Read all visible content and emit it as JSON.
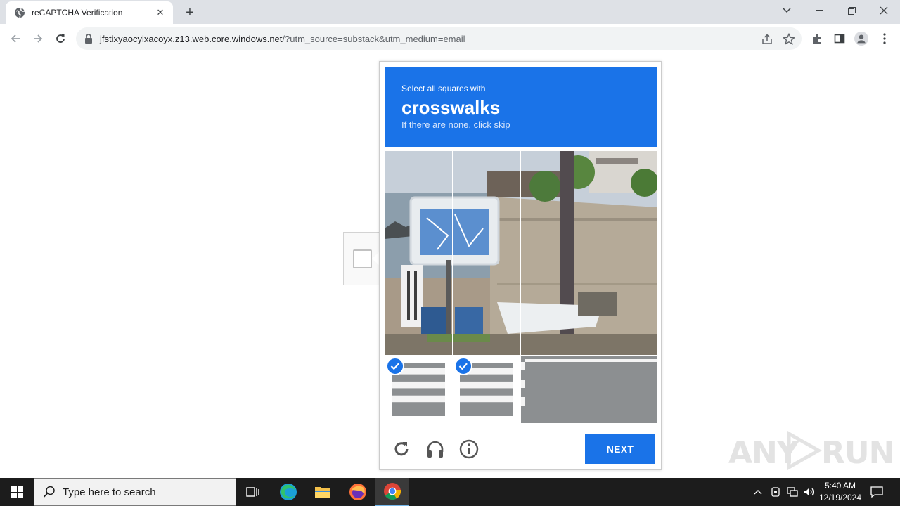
{
  "browser": {
    "tab_title": "reCAPTCHA Verification",
    "tab_close": "✕",
    "new_tab": "+",
    "url_host": "jfstixyaocyixacoyx.z13.web.core.windows.net",
    "url_rest": "/?utm_source=substack&utm_medium=email"
  },
  "captcha": {
    "instruction_small": "Select all squares with",
    "target": "crosswalks",
    "instruction_sub": "If there are none, click skip",
    "next_label": "NEXT",
    "selected_tiles": [
      12,
      13
    ],
    "tile_count": 16
  },
  "watermark": {
    "left": "ANY",
    "right": "RUN"
  },
  "taskbar": {
    "search_placeholder": "Type here to search",
    "time": "5:40 AM",
    "date": "12/19/2024"
  },
  "colors": {
    "accent": "#1a73e8"
  }
}
